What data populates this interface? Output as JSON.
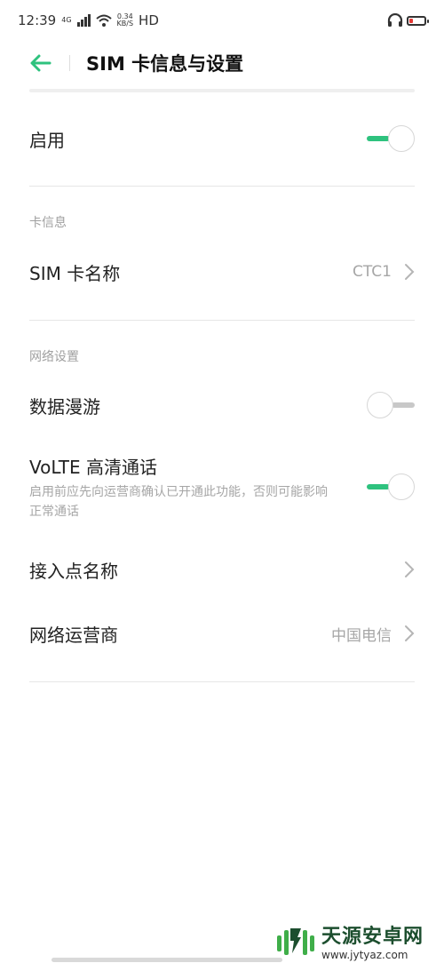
{
  "status_bar": {
    "time": "12:39",
    "network": "4G",
    "speed_value": "0.34",
    "speed_unit": "KB/S",
    "hd": "HD",
    "icons": [
      "signal-icon",
      "wifi-icon",
      "headphones-icon",
      "battery-icon"
    ]
  },
  "header": {
    "title": "SIM 卡信息与设置",
    "back_icon": "back-arrow-icon"
  },
  "enable": {
    "label": "启用",
    "toggle_on": true
  },
  "card_info": {
    "section_title": "卡信息",
    "sim_name_label": "SIM 卡名称",
    "sim_name_value": "CTC1"
  },
  "network": {
    "section_title": "网络设置",
    "roaming_label": "数据漫游",
    "roaming_on": false,
    "volte_label": "VoLTE 高清通话",
    "volte_desc": "启用前应先向运营商确认已开通此功能，否则可能影响正常通话",
    "volte_on": true,
    "apn_label": "接入点名称",
    "carrier_label": "网络运营商",
    "carrier_value": "中国电信"
  },
  "watermark": {
    "name": "天源安卓网",
    "url": "www.jytyaz.com"
  },
  "colors": {
    "accent": "#2ec27e",
    "text_primary": "#222222",
    "text_secondary": "#a6a6a6"
  }
}
